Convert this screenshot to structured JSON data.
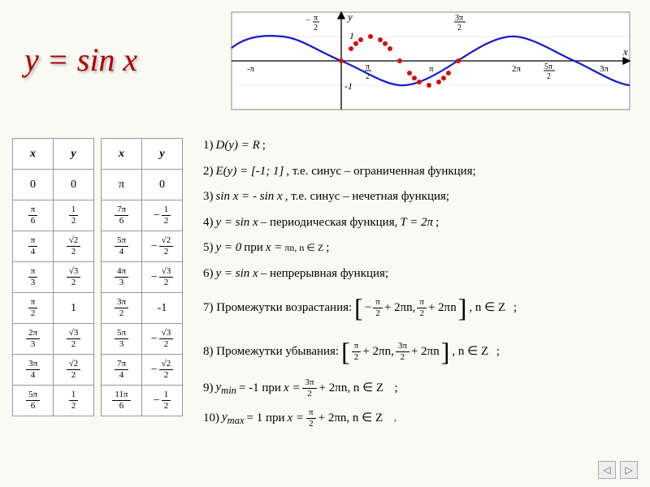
{
  "title": "y = sin x",
  "chart_data": {
    "type": "line",
    "title": "",
    "xlabel": "x",
    "ylabel": "y",
    "xlim": [
      -3.8,
      10.0
    ],
    "ylim": [
      -1.3,
      1.3
    ],
    "x_ticks": [
      {
        "val": -3.1416,
        "label": "-π"
      },
      {
        "val": -1.5708,
        "label": "-π/2"
      },
      {
        "val": 1.5708,
        "label": "π/2"
      },
      {
        "val": 3.1416,
        "label": "π"
      },
      {
        "val": 4.7124,
        "label": "3π/2"
      },
      {
        "val": 6.2832,
        "label": "2π"
      },
      {
        "val": 7.854,
        "label": "5π/2"
      },
      {
        "val": 9.4248,
        "label": "3π"
      }
    ],
    "y_ticks": [
      {
        "val": 1,
        "label": "1"
      },
      {
        "val": -1,
        "label": "-1"
      }
    ],
    "series": [
      {
        "name": "sin x",
        "type": "line",
        "color": "#0000b0"
      }
    ],
    "marker_points_x_over_pi": [
      0,
      0.1667,
      0.25,
      0.3333,
      0.5,
      0.6667,
      0.75,
      0.8333,
      1,
      1.1667,
      1.25,
      1.3333,
      1.5,
      1.6667,
      1.75,
      1.8333,
      2
    ]
  },
  "table_left": {
    "headers": [
      "x",
      "y"
    ],
    "rows": [
      [
        "0",
        "0"
      ],
      [
        "π/6",
        "1/2"
      ],
      [
        "π/4",
        "√2/2"
      ],
      [
        "π/3",
        "√3/2"
      ],
      [
        "π/2",
        "1"
      ],
      [
        "2π/3",
        "√3/2"
      ],
      [
        "3π/4",
        "√2/2"
      ],
      [
        "5π/6",
        "1/2"
      ]
    ]
  },
  "table_right": {
    "headers": [
      "x",
      "y"
    ],
    "rows": [
      [
        "π",
        "0"
      ],
      [
        "7π/6",
        "-1/2"
      ],
      [
        "5π/4",
        "-√2/2"
      ],
      [
        "4π/3",
        "-√3/2"
      ],
      [
        "3π/2",
        "-1"
      ],
      [
        "5π/3",
        "-√3/2"
      ],
      [
        "7π/4",
        "-√2/2"
      ],
      [
        "11π/6",
        "-1/2"
      ]
    ]
  },
  "properties": {
    "p1_a": "1) ",
    "p1_b": "D(y) = R",
    "p1_c": ";",
    "p2_a": "2) ",
    "p2_b": "E(y) = [-1; 1]",
    "p2_c": ", т.е. синус – ограниченная функция;",
    "p3_a": "3) ",
    "p3_b": "sin x = - sin x",
    "p3_c": ", т.е. синус – нечетная функция;",
    "p4_a": "4) ",
    "p4_b": "y = sin x",
    "p4_c": " – периодическая функция, ",
    "p4_d": "T = 2π",
    "p4_e": ";",
    "p5_a": "5) ",
    "p5_b": "y = 0",
    "p5_c": " при ",
    "p5_d": "x = ",
    "p5_e": "πn, n ∈ Z",
    "p5_f": ";",
    "p6_a": "6) ",
    "p6_b": "y = sin x",
    "p6_c": " – непрерывная функция;",
    "p7_a": "7) Промежутки возрастания: ",
    "p7_int_l": "-π/2",
    "p7_int_r": "π/2",
    "p7_tail": "+ 2πn",
    "p7_cond": ", n ∈ Z",
    "p8_a": "8) Промежутки убывания: ",
    "p8_int_l": "π/2",
    "p8_int_r": "3π/2",
    "p9_a": "9) ",
    "p9_b": "y",
    "p9_sub": "min",
    "p9_c": " = -1 при ",
    "p9_x": "x = ",
    "p9_ex": "3π/2",
    "p9_tail": "+ 2πn, n ∈ Z",
    "p10_a": "10) ",
    "p10_b": "y",
    "p10_sub": "max",
    "p10_c": " = 1 при ",
    "p10_x": "x = ",
    "p10_ex": "π/2",
    "p10_tail": "+ 2πn, n ∈ Z",
    "semi": ";",
    "dot": "."
  },
  "nav": {
    "prev": "◁",
    "next": "▷"
  }
}
